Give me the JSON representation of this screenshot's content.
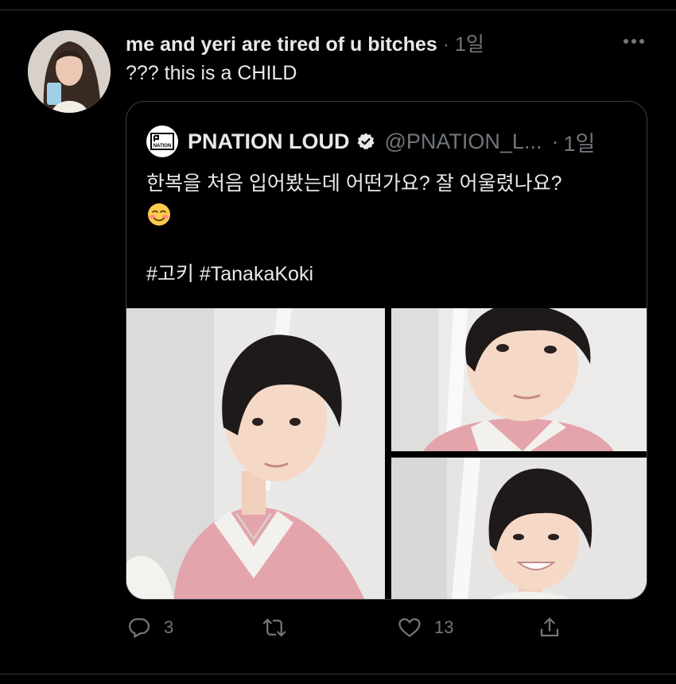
{
  "tweet": {
    "author_name": "me and yeri are tired of u bitches",
    "separator": "·",
    "time": "1일",
    "text": "??? this is a CHILD"
  },
  "quote": {
    "author_name": "PNATION LOUD",
    "handle": "@PNATION_L...",
    "separator": "·",
    "time": "1일",
    "body_line1": "한복을 처음 입어봤는데 어떤가요? 잘 어울렸나요?",
    "hashtags": "#고키 #TanakaKoki",
    "logo_text": "NATION"
  },
  "actions": {
    "reply_count": "3",
    "retweet_count": "",
    "like_count": "13"
  },
  "colors": {
    "background": "#000000",
    "text": "#e7e9ea",
    "muted": "#71767b",
    "border": "#2f3336",
    "hanbok_pink": "#e3a4ab"
  }
}
